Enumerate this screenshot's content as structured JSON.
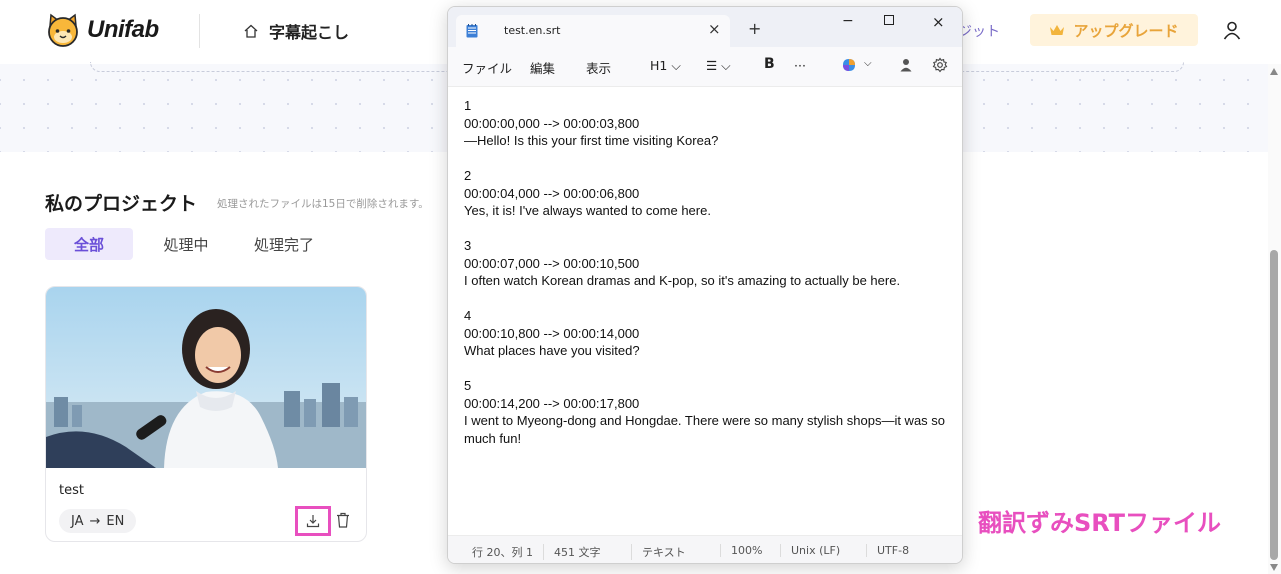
{
  "header": {
    "logo_text": "Unifab",
    "nav_label": "字幕起こし",
    "credit_label": "ジット",
    "upgrade_label": "アップグレード"
  },
  "projects": {
    "title": "私のプロジェクト",
    "note": "処理されたファイルは15日で削除されます。",
    "tabs": [
      {
        "label": "全部",
        "active": true
      },
      {
        "label": "処理中",
        "active": false
      },
      {
        "label": "処理完了",
        "active": false
      }
    ],
    "cards": [
      {
        "name": "test",
        "from_lang": "JA",
        "arrow": "→",
        "to_lang": "EN"
      }
    ]
  },
  "caption": "翻訳ずみSRTファイル",
  "notepad": {
    "tab_title": "test.en.srt",
    "tab_close": "×",
    "new_tab": "+",
    "window_buttons": {
      "minimize": "−",
      "close": "×"
    },
    "menu": {
      "file": "ファイル",
      "edit": "編集",
      "view": "表示",
      "heading": "H1 ⌵",
      "list": "☰ ⌵",
      "bold": "B",
      "more": "···",
      "copilot_chevron": "⌵"
    },
    "content": "1\n00:00:00,000 --> 00:00:03,800\n—Hello! Is this your first time visiting Korea?\n\n2\n00:00:04,000 --> 00:00:06,800\nYes, it is! I've always wanted to come here.\n\n3\n00:00:07,000 --> 00:00:10,500\nI often watch Korean dramas and K-pop, so it's amazing to actually be here.\n\n4\n00:00:10,800 --> 00:00:14,000\nWhat places have you visited?\n\n5\n00:00:14,200 --> 00:00:17,800\nI went to Myeong-dong and Hongdae. There were so many stylish shops—it was so much fun!",
    "status": {
      "position": "行 20、列 1",
      "chars": "451 文字",
      "mode": "テキスト",
      "zoom": "100%",
      "line_ending": "Unix (LF)",
      "encoding": "UTF-8"
    }
  },
  "colors": {
    "accent_purple": "#6a4fd8",
    "highlight_pink": "#e84fbf",
    "upgrade_gold": "#e8a43a"
  }
}
